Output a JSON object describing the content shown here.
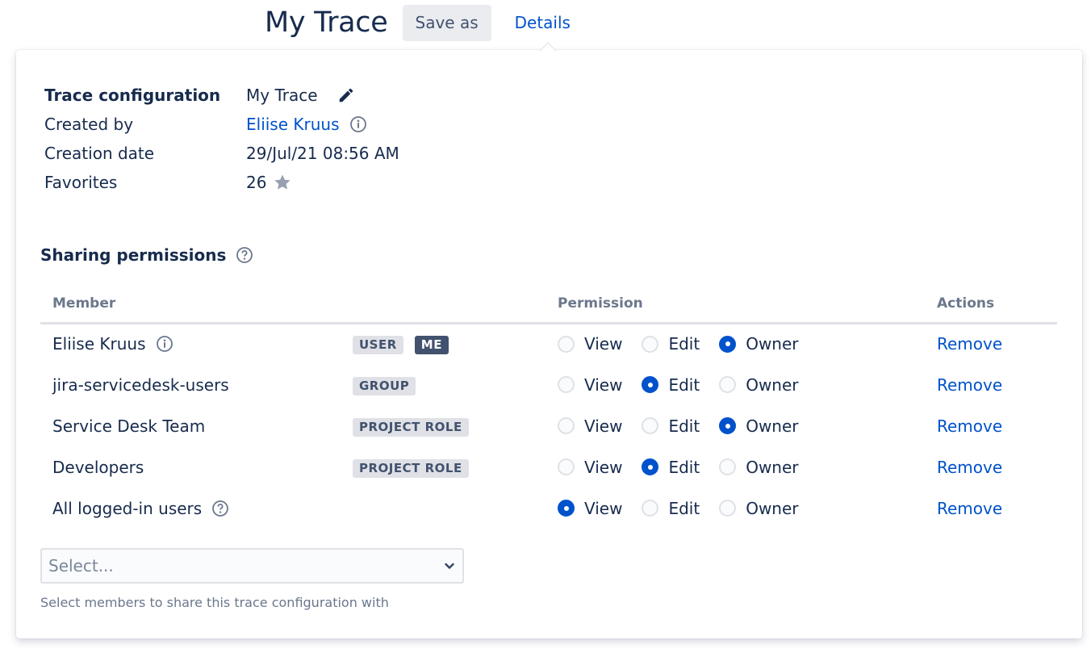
{
  "header": {
    "title": "My Trace",
    "save_as_label": "Save as",
    "details_label": "Details"
  },
  "details": {
    "trace_configuration_label": "Trace configuration",
    "trace_configuration_value": "My Trace",
    "created_by_label": "Created by",
    "created_by_value": "Eliise Kruus",
    "creation_date_label": "Creation date",
    "creation_date_value": "29/Jul/21 08:56 AM",
    "favorites_label": "Favorites",
    "favorites_value": "26"
  },
  "sharing": {
    "title": "Sharing permissions",
    "columns": {
      "member": "Member",
      "permission": "Permission",
      "actions": "Actions"
    },
    "permission_options": [
      "View",
      "Edit",
      "Owner"
    ],
    "remove_label": "Remove",
    "rows": [
      {
        "member": "Eliise Kruus",
        "member_icon": "info-icon",
        "badges": [
          "USER",
          "ME"
        ],
        "permission": "Owner"
      },
      {
        "member": "jira-servicedesk-users",
        "member_icon": null,
        "badges": [
          "GROUP"
        ],
        "permission": "Edit"
      },
      {
        "member": "Service Desk Team",
        "member_icon": null,
        "badges": [
          "PROJECT ROLE"
        ],
        "permission": "Owner"
      },
      {
        "member": "Developers",
        "member_icon": null,
        "badges": [
          "PROJECT ROLE"
        ],
        "permission": "Edit"
      },
      {
        "member": "All logged-in users",
        "member_icon": "help-icon",
        "badges": [],
        "permission": "View"
      }
    ],
    "select_placeholder": "Select...",
    "helper_text": "Select members to share this trace configuration with"
  },
  "colors": {
    "primary_text": "#172b4d",
    "link": "#0052cc",
    "muted": "#6b778c",
    "lozenge_bg": "#dfe1e6",
    "lozenge_dark_bg": "#42526e"
  }
}
